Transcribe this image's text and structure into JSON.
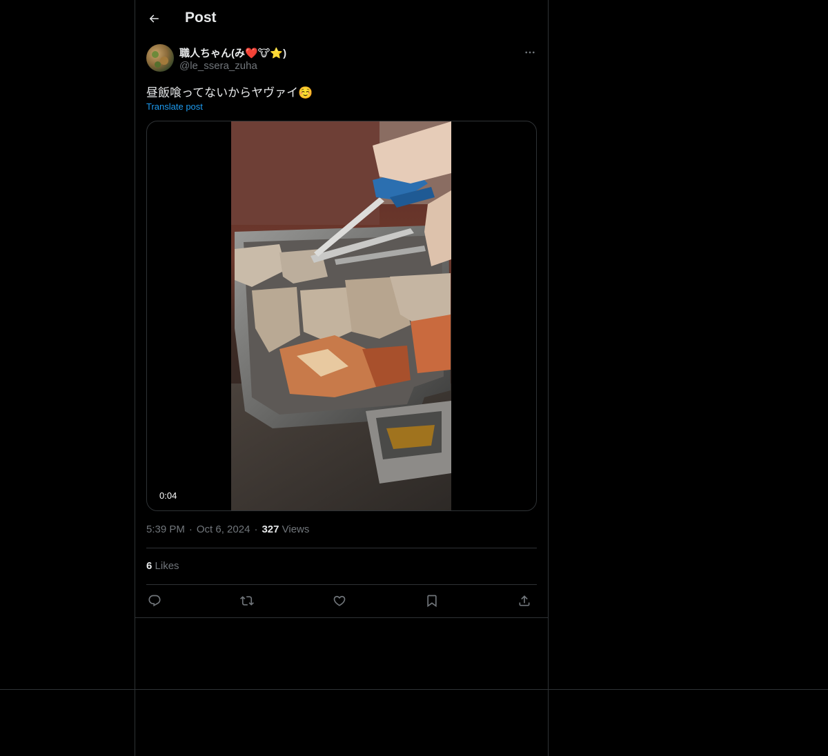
{
  "header": {
    "title": "Post",
    "back_icon": "arrow-left-icon"
  },
  "author": {
    "display_name": "職人ちゃん(み❤️🐮⭐)",
    "handle": "@le_ssera_zuha"
  },
  "post": {
    "text": "昼飯喰ってないからヤヴァイ☺️",
    "translate_label": "Translate post"
  },
  "media": {
    "type": "video",
    "duration": "0:04"
  },
  "meta": {
    "time": "5:39 PM",
    "date": "Oct 6, 2024",
    "views_count": "327",
    "views_label": "Views"
  },
  "stats": {
    "likes_count": "6",
    "likes_label": "Likes"
  },
  "actions": [
    {
      "name": "reply",
      "icon": "reply-icon"
    },
    {
      "name": "repost",
      "icon": "repost-icon"
    },
    {
      "name": "like",
      "icon": "heart-icon"
    },
    {
      "name": "bookmark",
      "icon": "bookmark-icon"
    },
    {
      "name": "share",
      "icon": "share-icon"
    }
  ],
  "colors": {
    "background": "#000000",
    "text_primary": "#e7e9ea",
    "text_secondary": "#71767b",
    "accent": "#1d9bf0",
    "border": "#2f3336"
  }
}
